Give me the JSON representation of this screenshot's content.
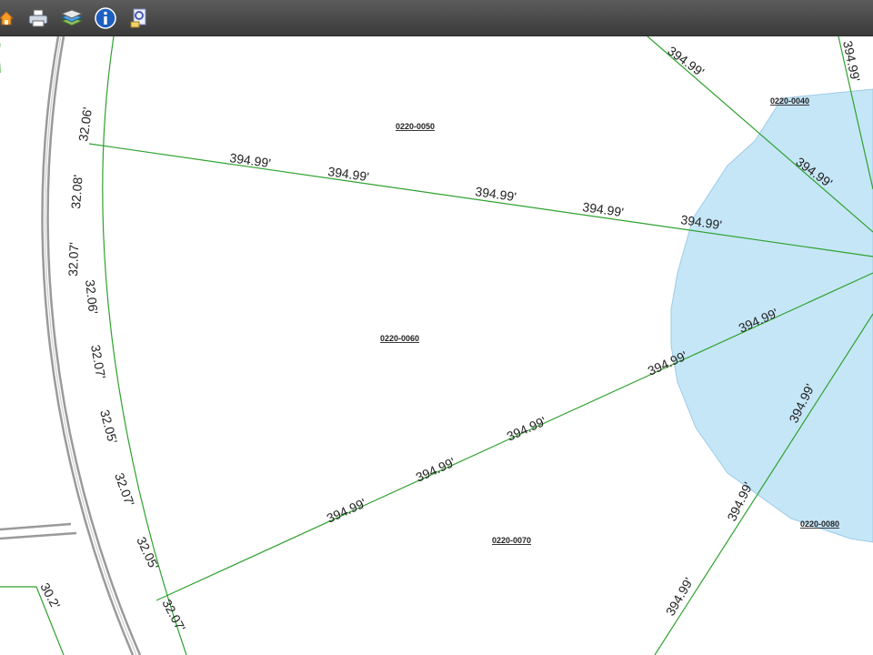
{
  "toolbar": {
    "buttons": [
      {
        "name": "home-icon",
        "color": "#f59a23"
      },
      {
        "name": "print-icon",
        "color": "#cfd8e3"
      },
      {
        "name": "layers-icon",
        "color": "#4aa3df"
      },
      {
        "name": "info-icon",
        "color": "#1f5fbf"
      },
      {
        "name": "identify-icon",
        "color": "#9aa7d6"
      }
    ]
  },
  "map": {
    "colors": {
      "parcel_line": "#2fa12f",
      "highlight_fill": "#c5e6f7",
      "highlight_stroke": "#9fcbe6",
      "road": "#9a9a9a"
    },
    "parcels": {
      "p50": "0220-0050",
      "p40": "0220-0040",
      "p60": "0220-0060",
      "p70": "0220-0070",
      "p80": "0220-0080"
    },
    "dims": {
      "rad": "394.99'",
      "a1": "32.06'",
      "a2": "32.08'",
      "a3": "32.07'",
      "a4": "32.06'",
      "a5": "32.07'",
      "a6": "32.05'",
      "a7": "32.07'",
      "a8": "32.05'",
      "a9": "32.07'",
      "sw": "30.2'"
    }
  }
}
